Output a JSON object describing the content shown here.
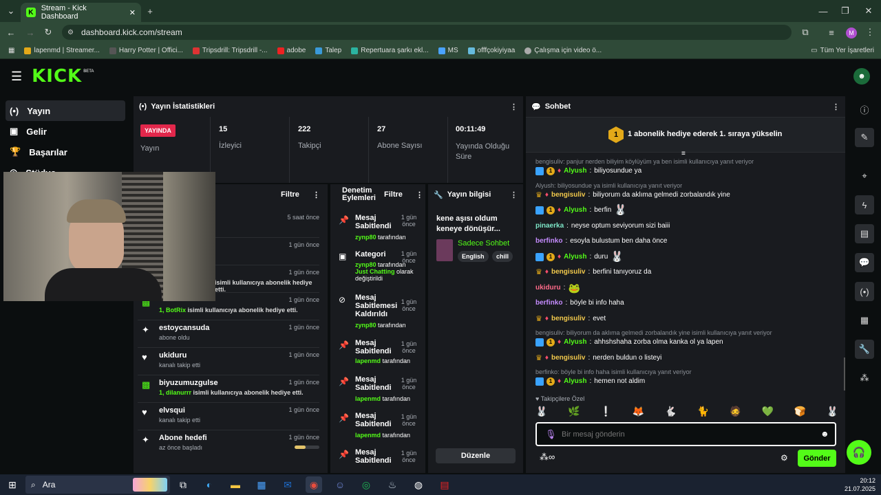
{
  "browser": {
    "tab_title": "Stream - Kick Dashboard",
    "url": "dashboard.kick.com/stream",
    "profile_initial": "M",
    "bookmarks": [
      "lapenmd | Streamer...",
      "Harry Potter | Offici...",
      "Tripsdrill: Tripsdrill -...",
      "adobe",
      "Talep",
      "Repertuara şarkı ekl...",
      "MS",
      "offfçokiyiyaa",
      "Çalışma için video ö..."
    ],
    "all_bookmarks": "Tüm Yer İşaretleri"
  },
  "brand": {
    "logo": "KICK",
    "beta": "BETA",
    "accent": "#53fc18"
  },
  "sidebar": {
    "items": [
      "Yayın",
      "Gelir",
      "Başarılar",
      "Stüdyo"
    ]
  },
  "stats": {
    "title": "Yayın İstatistikleri",
    "live_badge": "YAYINDA",
    "live_label": "Yayın",
    "items": [
      {
        "value": "15",
        "label": "İzleyici"
      },
      {
        "value": "222",
        "label": "Takipçi"
      },
      {
        "value": "27",
        "label": "Abone Sayısı"
      },
      {
        "value": "00:11:49",
        "label": "Yayında Olduğu Süre"
      }
    ]
  },
  "activity": {
    "filter": "Filtre",
    "items": [
      {
        "title": "",
        "desc": "",
        "time": "5 saat önce"
      },
      {
        "title": "",
        "desc": "",
        "time": "1 gün önce"
      },
      {
        "title": "",
        "desc": "isimli kullanıcıya abonelik hediye etti.",
        "time": "1 gün önce"
      },
      {
        "title": "",
        "user": "1, BotRix",
        "desc": "isimli kullanıcıya abonelik hediye etti.",
        "time": "1 gün önce"
      },
      {
        "title": "estoycansuda",
        "desc": "abone oldu",
        "time": "1 gün önce"
      },
      {
        "title": "ukiduru",
        "desc": "kanalı takip etti",
        "time": "1 gün önce"
      },
      {
        "title": "biyuzumuzgulse",
        "user": "1, dilanurrr",
        "desc": "isimli kullanıcıya abonelik hediye etti.",
        "time": "1 gün önce"
      },
      {
        "title": "elvsqui",
        "desc": "kanalı takip etti",
        "time": "1 gün önce"
      },
      {
        "title": "Abone hedefi",
        "desc": "az önce başladı",
        "time": "1 gün önce",
        "progress": 0.45
      }
    ]
  },
  "moderation": {
    "title1": "Denetim",
    "title2": "Eylemleri",
    "filter": "Filtre",
    "suffix": "tarafından",
    "items": [
      {
        "l1": "Mesaj",
        "l2": "Sabitlendi",
        "l3": "",
        "user": "zynp80",
        "t1": "1 gün",
        "t2": "önce"
      },
      {
        "l1": "Kategori",
        "l2": "",
        "l3": "",
        "user": "zynp80",
        "extra1": "Just Chatting",
        "extra2": "olarak",
        "extra3": "değiştirildi",
        "t1": "1 gün",
        "t2": "önce"
      },
      {
        "l1": "Mesaj",
        "l2": "Sabitlemesi",
        "l3": "Kaldırıldı",
        "user": "zynp80",
        "t1": "1 gün",
        "t2": "önce"
      },
      {
        "l1": "Mesaj",
        "l2": "Sabitlendi",
        "l3": "",
        "user": "lapenmd",
        "t1": "1 gün",
        "t2": "önce"
      },
      {
        "l1": "Mesaj",
        "l2": "Sabitlendi",
        "l3": "",
        "user": "lapenmd",
        "t1": "1 gün",
        "t2": "önce"
      },
      {
        "l1": "Mesaj",
        "l2": "Sabitlendi",
        "l3": "",
        "user": "lapenmd",
        "t1": "1 gün",
        "t2": "önce"
      },
      {
        "l1": "Mesaj",
        "l2": "Sabitlendi",
        "l3": "",
        "user": "",
        "t1": "1 gün",
        "t2": "önce"
      }
    ]
  },
  "stream_info": {
    "title": "Yayın bilgisi",
    "stream_title_1": "kene aşısı oldum",
    "stream_title_2": "keneye dönüşür...",
    "category": "Sadece Sohbet",
    "tags": [
      "English",
      "chill"
    ],
    "edit": "Düzenle"
  },
  "chat": {
    "title": "Sohbet",
    "banner": "1 abonelik hediye ederek 1. sıraya yükselin",
    "banner_rank": "1",
    "messages": [
      {
        "type": "reply",
        "text": "bengisuliv: panjur nerden biliyim köylüyüm ya ben isimli kullanıcıya yanıt veriyor"
      },
      {
        "user": "Alyush",
        "color": "#53fc18",
        "text": "biliyosundue ya",
        "badges": "mod"
      },
      {
        "type": "reply",
        "text": "Alyush: biliyosundue ya isimli kullanıcıya yanıt veriyor"
      },
      {
        "user": "bengisuliv",
        "color": "#f2c94c",
        "text": "biliyorum da aklıma gelmedi zorbalandık yine",
        "badges": "crown"
      },
      {
        "user": "Alyush",
        "color": "#53fc18",
        "text": "berfin",
        "badges": "mod",
        "emote": true
      },
      {
        "user": "pinaerka",
        "color": "#7ee7c8",
        "text": "neyse optum seviyorum sizi baiii",
        "badges": ""
      },
      {
        "user": "berfinko",
        "color": "#c58cff",
        "text": "esoyla bulustum ben daha önce",
        "badges": ""
      },
      {
        "user": "Alyush",
        "color": "#53fc18",
        "text": "duru",
        "badges": "mod",
        "emote": true
      },
      {
        "user": "bengisuliv",
        "color": "#f2c94c",
        "text": "berfini tanıyoruz da",
        "badges": "crown"
      },
      {
        "user": "ukiduru",
        "color": "#ff6b8a",
        "text": "",
        "badges": "",
        "emote": true
      },
      {
        "user": "berfinko",
        "color": "#c58cff",
        "text": "böyle bi info haha",
        "badges": ""
      },
      {
        "user": "bengisuliv",
        "color": "#f2c94c",
        "text": "evet",
        "badges": "crown"
      },
      {
        "type": "reply",
        "text": "bengisuliv: biliyorum da aklıma gelmedi zorbalandık yine isimli kullanıcıya yanıt veriyor"
      },
      {
        "user": "Alyush",
        "color": "#53fc18",
        "text": "ahhshshaha zorba olma kanka ol ya lapen",
        "badges": "mod"
      },
      {
        "user": "bengisuliv",
        "color": "#f2c94c",
        "text": "nerden buldun o listeyi",
        "badges": "crown"
      },
      {
        "type": "reply",
        "text": "berfinko: böyle bi info haha isimli kullanıcıya yanıt veriyor"
      },
      {
        "user": "Alyush",
        "color": "#53fc18",
        "text": "hemen not aldim",
        "badges": "mod"
      }
    ],
    "followers_only": "Takipçilere Özel",
    "input_placeholder": "Bir mesaj gönderin",
    "send": "Gönder"
  },
  "taskbar": {
    "search": "Ara",
    "time": "20:12",
    "date": "21.07.2025"
  }
}
